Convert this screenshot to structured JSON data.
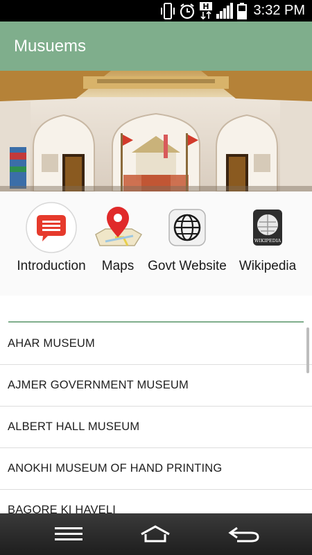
{
  "status_bar": {
    "time": "3:32 PM",
    "network_badge": "H",
    "icons": [
      "vibrate-icon",
      "alarm-icon",
      "data-arrows-icon",
      "signal-icon",
      "battery-icon"
    ]
  },
  "app_bar": {
    "title": "Musuems",
    "color": "#7fae8c"
  },
  "quick_links": [
    {
      "label": "Introduction",
      "icon": "chat-bubble-icon"
    },
    {
      "label": "Maps",
      "icon": "map-pin-icon"
    },
    {
      "label": "Govt Website",
      "icon": "globe-icon"
    },
    {
      "label": "Wikipedia",
      "icon": "wikipedia-icon"
    }
  ],
  "wikipedia_logo_text": "WIKIPEDIA",
  "museums": [
    "AHAR MUSEUM",
    "AJMER GOVERNMENT MUSEUM",
    "ALBERT HALL MUSEUM",
    "ANOKHI MUSEUM OF HAND PRINTING",
    "BAGORE KI HAVELI"
  ],
  "nav_bar": {
    "buttons": [
      "menu-icon",
      "home-icon",
      "back-icon"
    ]
  }
}
